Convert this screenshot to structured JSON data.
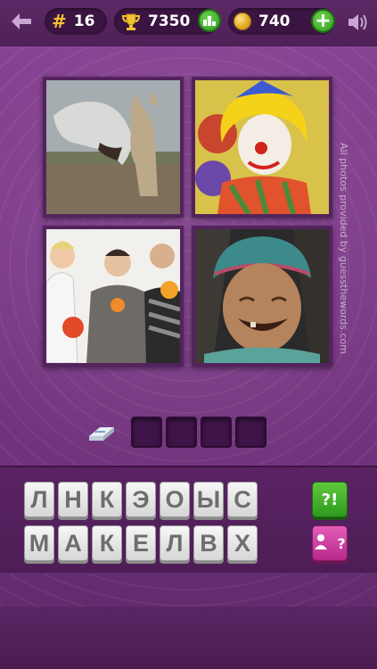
{
  "header": {
    "level_symbol": "#",
    "level": "16",
    "score": "7350",
    "coins": "740",
    "plus": "+"
  },
  "icons": {
    "back": "back-arrow-icon",
    "trophy": "trophy-icon",
    "ranking": "ranking-icon",
    "coin": "coin-icon",
    "add_coins": "plus-icon",
    "sound": "speaker-icon",
    "eraser": "eraser-icon",
    "solve": "question-exclaim-icon",
    "ask_friend": "ask-friend-icon"
  },
  "photos": [
    {
      "subject": "horses"
    },
    {
      "subject": "clown"
    },
    {
      "subject": "men with flowers"
    },
    {
      "subject": "smiling woman"
    }
  ],
  "credit": "All photos provided by guessthewords.com",
  "answer": {
    "slots": [
      "",
      "",
      "",
      ""
    ]
  },
  "keyboard": {
    "row1": [
      "Л",
      "Н",
      "К",
      "Э",
      "О",
      "Ы",
      "С"
    ],
    "row2": [
      "М",
      "А",
      "К",
      "Е",
      "Л",
      "В",
      "Х"
    ]
  },
  "hints": {
    "solve_label": "?!",
    "friend_label": "?"
  },
  "colors": {
    "background": "#7a3b86",
    "panel": "#5a2263",
    "accent_green": "#3fae28",
    "accent_pink": "#c8349b",
    "gold": "#f2c230"
  }
}
